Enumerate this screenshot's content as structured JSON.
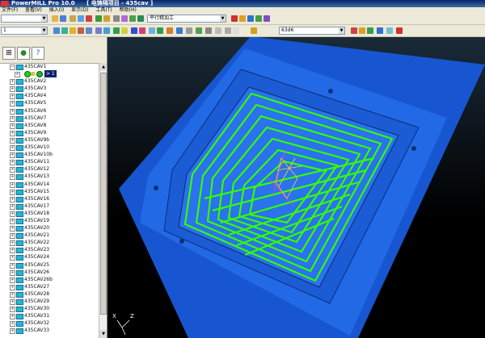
{
  "titlebar": {
    "app": "PowerMILL Pro 10.0",
    "project": "[ 电铸隔项目 - 435cav ]"
  },
  "menubar": {
    "items": [
      "文件(F)",
      "查看(V)",
      "插入(I)",
      "显示(D)",
      "工具(T)",
      "帮助(H)"
    ]
  },
  "toolbar1": {
    "toolpath_strategy": "平行精加工"
  },
  "toolbar2": {
    "tool_combo": "1",
    "tool_name": "63d6"
  },
  "tree": {
    "root": "435CAV1",
    "selected_item": "> 1",
    "items": [
      "435CAV2",
      "435CAV3",
      "435CAV4",
      "435CAV5",
      "435CAV6",
      "435CAV7",
      "435CAV8",
      "435CAV9",
      "435CAV9b",
      "435CAV10",
      "435CAV10b",
      "435CAV11",
      "435CAV12",
      "435CAV13",
      "435CAV14",
      "435CAV15",
      "435CAV16",
      "435CAV17",
      "435CAV18",
      "435CAV19",
      "435CAV20",
      "435CAV21",
      "435CAV22",
      "435CAV23",
      "435CAV24",
      "435CAV25",
      "435CAV26",
      "435CAV26b",
      "435CAV27",
      "435CAV28",
      "435CAV29",
      "435CAV30",
      "435CAV31",
      "435CAV32",
      "435CAV33"
    ]
  },
  "axes": {
    "x": "X",
    "z": "Z"
  },
  "colors": {
    "block": "#1e63e0",
    "toolpath": "#33ff00",
    "background": "#000000"
  }
}
